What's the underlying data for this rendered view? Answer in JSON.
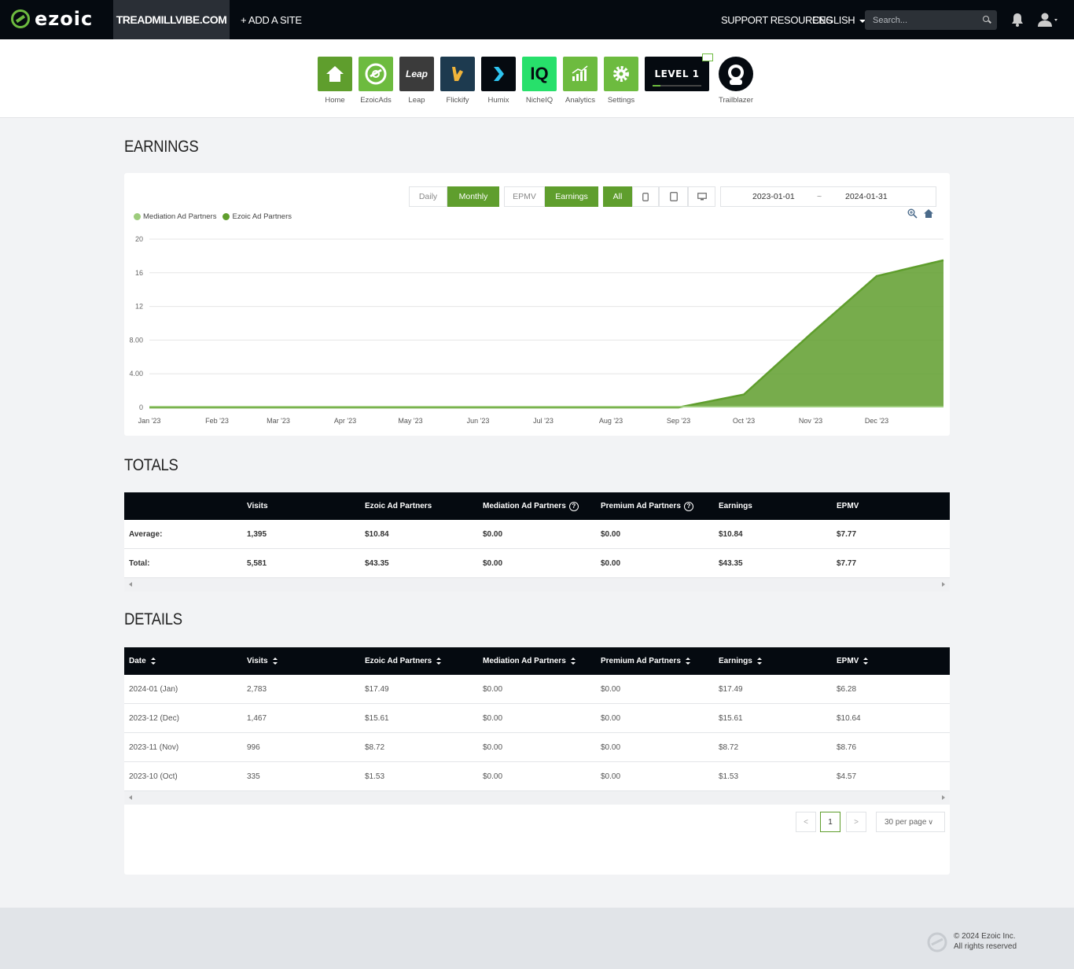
{
  "topbar": {
    "brand": "ezoic",
    "site": "TREADMILLVIBE.COM",
    "add_site": "+ ADD A SITE",
    "support": "SUPPORT RESOURCES",
    "language": "ENGLISH",
    "search_placeholder": "Search..."
  },
  "apps": [
    {
      "label": "Home",
      "color": "#5f9e2d"
    },
    {
      "label": "EzoicAds",
      "color": "#6dbb3f"
    },
    {
      "label": "Leap",
      "tile_text": "Leap",
      "color": "#3b3b3b"
    },
    {
      "label": "Flickify",
      "color": "#1d3a4f"
    },
    {
      "label": "Humix",
      "color": "#050a10"
    },
    {
      "label": "NicheIQ",
      "tile_text": "IQ",
      "color": "#27e06b"
    },
    {
      "label": "Analytics",
      "color": "#6dbb3f"
    },
    {
      "label": "Settings",
      "color": "#6dbb3f"
    }
  ],
  "level": {
    "label": "LEVEL 1",
    "progress": 0.15
  },
  "trailblazer": {
    "label": "Trailblazer"
  },
  "earnings": {
    "title": "EARNINGS",
    "period_buttons": [
      "Daily",
      "Monthly"
    ],
    "metric_buttons": [
      "EPMV",
      "Earnings"
    ],
    "device_all": "All",
    "date_start": "2023-01-01",
    "date_sep": "~",
    "date_end": "2024-01-31",
    "colors": {
      "mediation": "#9dcc7c",
      "ezoic": "#5f9e2d"
    }
  },
  "chart_data": {
    "type": "area",
    "x": [
      "Jan '23",
      "Feb '23",
      "Mar '23",
      "Apr '23",
      "May '23",
      "Jun '23",
      "Jul '23",
      "Aug '23",
      "Sep '23",
      "Oct '23",
      "Nov '23",
      "Dec '23",
      "Jan '24"
    ],
    "x_tick_labels": [
      "Jan '23",
      "Feb '23",
      "Mar '23",
      "Apr '23",
      "May '23",
      "Jun '23",
      "Jul '23",
      "Aug '23",
      "Sep '23",
      "Oct '23",
      "Nov '23",
      "Dec '23"
    ],
    "series": [
      {
        "name": "Mediation Ad Partners",
        "values": [
          0,
          0,
          0,
          0,
          0,
          0,
          0,
          0,
          0,
          0,
          0,
          0,
          0
        ]
      },
      {
        "name": "Ezoic Ad Partners",
        "values": [
          0,
          0,
          0,
          0,
          0,
          0,
          0,
          0,
          0,
          1.53,
          8.72,
          15.61,
          17.49
        ]
      }
    ],
    "y_ticks": [
      "0",
      "4.00",
      "8.00",
      "12",
      "16",
      "20"
    ],
    "ylim": [
      0,
      20
    ],
    "grid": true,
    "legend": "top-left"
  },
  "totals": {
    "title": "TOTALS",
    "headers": [
      "Visits",
      "Ezoic Ad Partners",
      "Mediation Ad Partners",
      "Premium Ad Partners",
      "Earnings",
      "EPMV"
    ],
    "rows": [
      {
        "label": "Average:",
        "cells": [
          "1,395",
          "$10.84",
          "$0.00",
          "$0.00",
          "$10.84",
          "$7.77"
        ]
      },
      {
        "label": "Total:",
        "cells": [
          "5,581",
          "$43.35",
          "$0.00",
          "$0.00",
          "$43.35",
          "$7.77"
        ]
      }
    ]
  },
  "details": {
    "title": "DETAILS",
    "headers": [
      "Date",
      "Visits",
      "Ezoic Ad Partners",
      "Mediation Ad Partners",
      "Premium Ad Partners",
      "Earnings",
      "EPMV"
    ],
    "rows": [
      [
        "2024-01 (Jan)",
        "2,783",
        "$17.49",
        "$0.00",
        "$0.00",
        "$17.49",
        "$6.28"
      ],
      [
        "2023-12 (Dec)",
        "1,467",
        "$15.61",
        "$0.00",
        "$0.00",
        "$15.61",
        "$10.64"
      ],
      [
        "2023-11 (Nov)",
        "996",
        "$8.72",
        "$0.00",
        "$0.00",
        "$8.72",
        "$8.76"
      ],
      [
        "2023-10 (Oct)",
        "335",
        "$1.53",
        "$0.00",
        "$0.00",
        "$1.53",
        "$4.57"
      ]
    ],
    "pager": {
      "prev": "<",
      "page": "1",
      "next": ">",
      "per_page": "30 per page"
    }
  },
  "footer": {
    "copyright": "© 2024 Ezoic Inc.",
    "rights": "All rights reserved"
  }
}
